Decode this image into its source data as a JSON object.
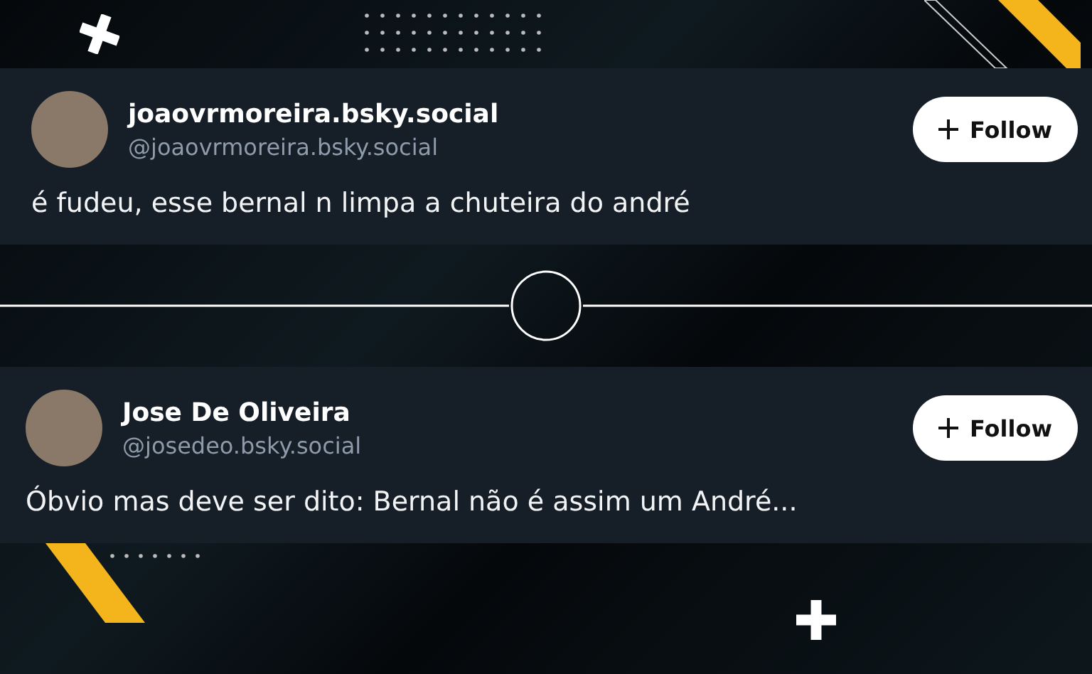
{
  "posts": [
    {
      "display_name": "joaovrmoreira.bsky.social",
      "handle": "@joaovrmoreira.bsky.social",
      "text": "é fudeu, esse bernal n limpa a chuteira do andré",
      "follow_label": "Follow"
    },
    {
      "display_name": "Jose De Oliveira",
      "handle": "@josedeo.bsky.social",
      "text": "Óbvio mas deve ser dito: Bernal não é assim um André...",
      "follow_label": "Follow"
    }
  ]
}
